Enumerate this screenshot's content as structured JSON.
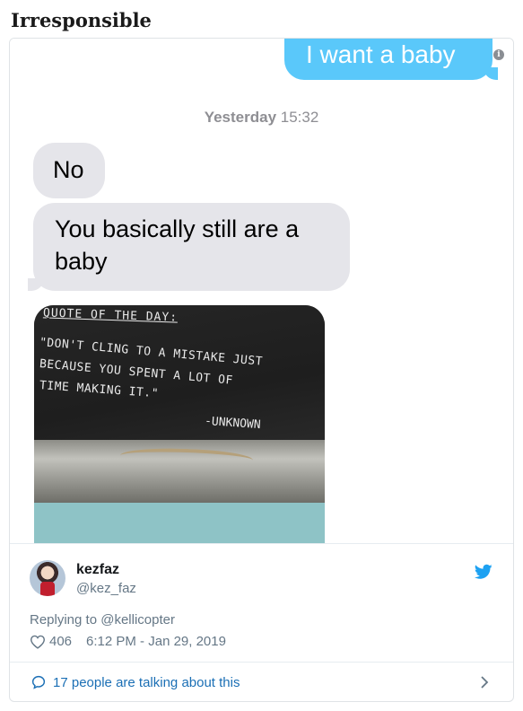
{
  "headline": "Irresponsible",
  "conversation": {
    "outgoing_message": "I want a baby",
    "timestamp_day": "Yesterday",
    "timestamp_time": "15:32",
    "incoming_messages": [
      "No",
      "You basically still are a baby"
    ],
    "photo": {
      "title": "QUOTE OF THE DAY:",
      "lines": [
        "\"DON'T CLING TO A MISTAKE JUST",
        "BECAUSE YOU SPENT A LOT OF",
        "TIME MAKING IT.\""
      ],
      "author": "-UNKNOWN"
    }
  },
  "tweet": {
    "display_name": "kezfaz",
    "handle": "@kez_faz",
    "replying_to": "Replying to @kellicopter",
    "likes": "406",
    "timestamp": "6:12 PM - Jan 29, 2019",
    "talking": "17 people are talking about this"
  },
  "colors": {
    "imessage_blue": "#5ac8fa",
    "incoming_gray": "#e5e5ea",
    "twitter_blue": "#1da1f2",
    "link_blue": "#1b6fb5"
  },
  "icons": [
    "info-icon",
    "twitter-bird-icon",
    "heart-icon",
    "chat-bubble-icon",
    "chevron-right-icon"
  ]
}
